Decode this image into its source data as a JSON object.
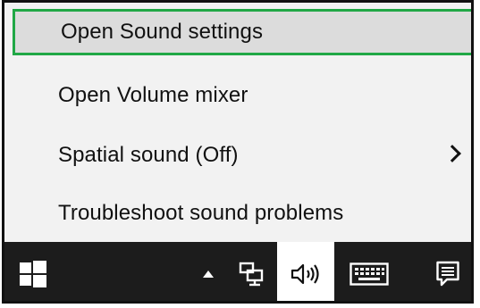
{
  "menu": {
    "items": [
      {
        "label": "Open Sound settings",
        "highlighted": true,
        "has_submenu": false
      },
      {
        "label": "Open Volume mixer",
        "highlighted": false,
        "has_submenu": false
      },
      {
        "label": "Spatial sound (Off)",
        "highlighted": false,
        "has_submenu": true
      },
      {
        "label": "Troubleshoot sound problems",
        "highlighted": false,
        "has_submenu": false
      }
    ]
  },
  "taskbar": {
    "icons": [
      {
        "name": "windows-start-icon"
      },
      {
        "name": "show-hidden-icons-arrow-icon"
      },
      {
        "name": "network-icon"
      },
      {
        "name": "volume-speaker-icon",
        "active": true
      },
      {
        "name": "touch-keyboard-icon"
      },
      {
        "name": "action-center-notifications-icon"
      }
    ]
  },
  "colors": {
    "menu_background": "#f2f2f2",
    "highlight_background": "#dcdcdc",
    "highlight_border": "#21a846",
    "taskbar_background": "#1c1c1c",
    "active_icon_background": "#ffffff"
  }
}
